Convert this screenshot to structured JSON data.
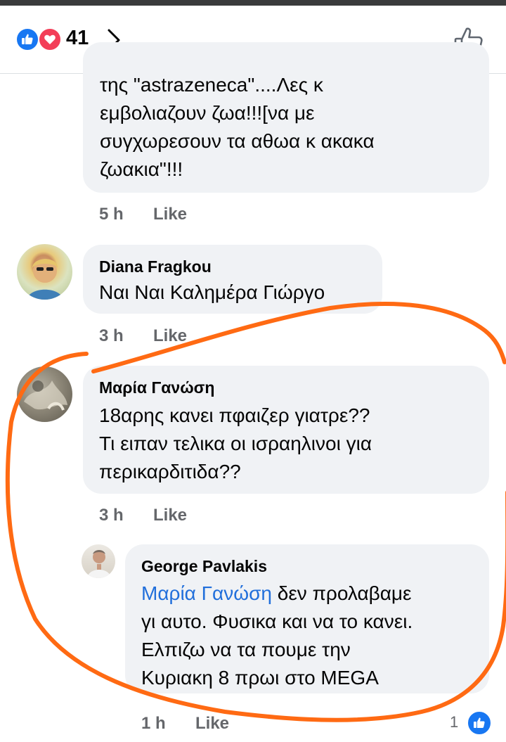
{
  "header": {
    "reaction_icons": [
      "like-icon",
      "love-icon"
    ],
    "reaction_count": "41",
    "chevron_icon": "chevron-right-icon",
    "like_action_icon": "thumbs-up-outline-icon"
  },
  "comments": [
    {
      "text": "της \"astrazeneca\"....Λες κ\nεμβολιαζουν ζωα!!![να με\nσυγχωρεσουν τα αθωα κ ακακα\nζωακια\"!!!",
      "time": "5 h",
      "like_label": "Like"
    },
    {
      "author": "Diana Fragkou",
      "text": "Ναι Ναι Καλημέρα Γιώργο",
      "time": "3 h",
      "like_label": "Like"
    },
    {
      "author": "Μαρία Γανώση",
      "text": "18αρης κανει πφαιζερ γιατρε??\nΤι ειπαν τελικα οι ισραηλινοι για\nπερικαρδιτιδα??",
      "time": "3 h",
      "like_label": "Like"
    },
    {
      "author": "George Pavlakis",
      "mention": "Μαρία Γανώση",
      "text": " δεν προλαβαμε\nγι αυτο. Φυσικα και να το κανει.\nΕλπιζω να τα πουμε την\nΚυριακη 8 πρωι στο MEGA",
      "time": "1 h",
      "like_label": "Like",
      "reaction_count": "1"
    }
  ],
  "colors": {
    "like_blue": "#1877f2",
    "love_red": "#f33e58",
    "bubble_bg": "#f0f2f5",
    "mention_blue": "#216fdb",
    "meta_gray": "#65676b",
    "scribble_orange": "#ff6a13"
  }
}
